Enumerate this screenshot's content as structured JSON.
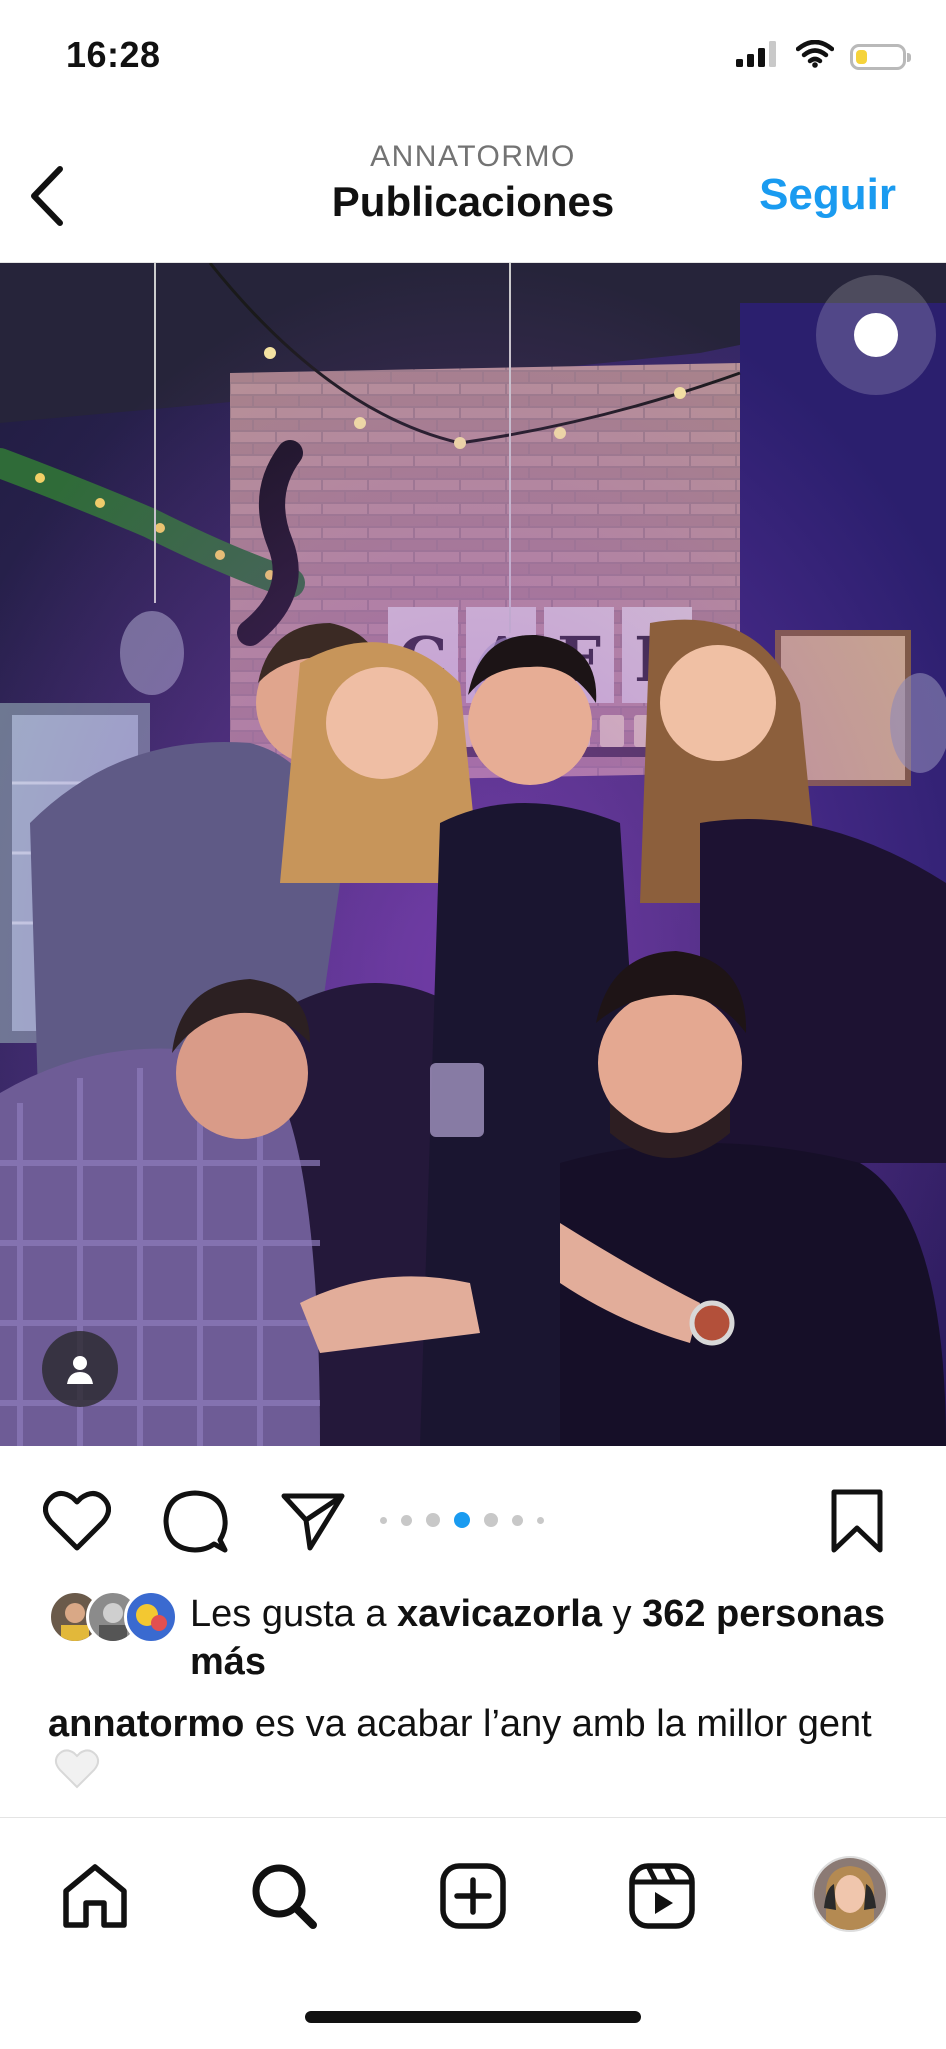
{
  "status_bar": {
    "time": "16:28",
    "icons": [
      "cellular-signal-icon",
      "wifi-icon",
      "battery-icon"
    ],
    "battery_level": 0.25,
    "battery_color": "#f5d33b"
  },
  "header": {
    "username": "ANNATORMO",
    "title": "Publicaciones",
    "follow_label": "Seguir",
    "accent_color": "#1a9bf0"
  },
  "post": {
    "photo_description_icon": "photo",
    "carousel": {
      "total": 7,
      "active_index": 3
    },
    "likes": {
      "prefix": "Les gusta a ",
      "first_user": "xavicazorla",
      "connector": " y ",
      "others": "362 personas más"
    },
    "caption": {
      "username": "annatormo",
      "text": " es va acabar l’any amb la millor gent"
    }
  },
  "tab_bar": {
    "items": [
      "home-icon",
      "search-icon",
      "new-post-icon",
      "reels-icon",
      "profile-avatar"
    ]
  }
}
